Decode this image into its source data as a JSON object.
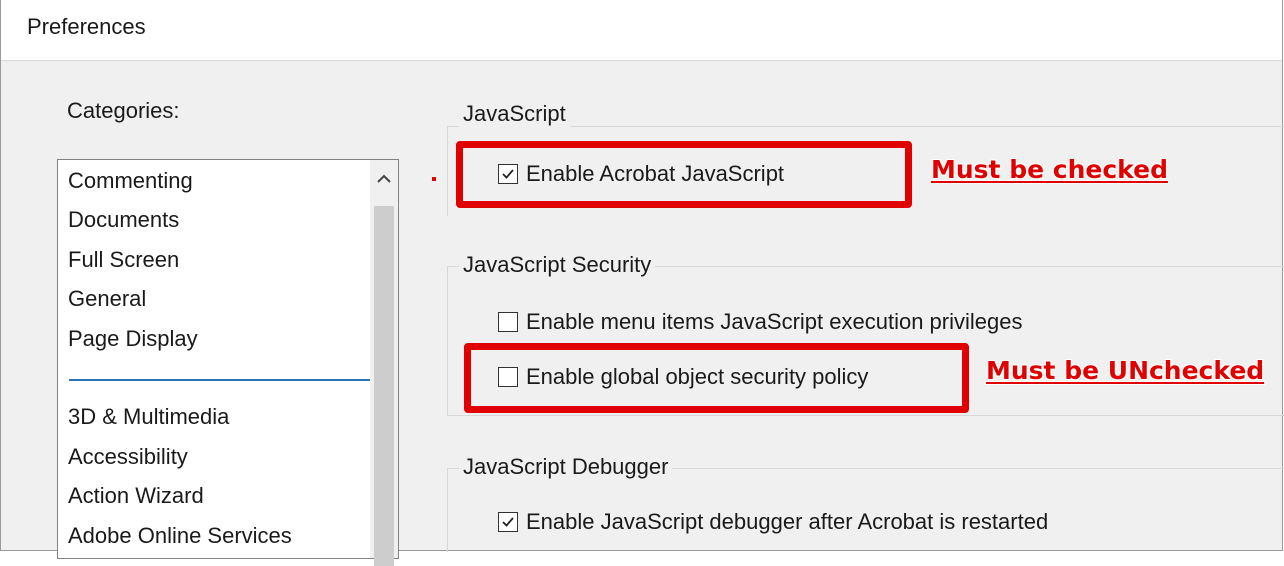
{
  "window": {
    "title": "Preferences"
  },
  "categories": {
    "label": "Categories:",
    "items": [
      "Commenting",
      "Documents",
      "Full Screen",
      "General",
      "Page Display",
      "3D & Multimedia",
      "Accessibility",
      "Action Wizard",
      "Adobe Online Services"
    ]
  },
  "javascript": {
    "title": "JavaScript",
    "enable_acrobat_js": {
      "label": "Enable Acrobat JavaScript",
      "checked": true
    }
  },
  "security": {
    "title": "JavaScript Security",
    "menu_items_privileges": {
      "label": "Enable menu items JavaScript execution privileges",
      "checked": false
    },
    "global_object_policy": {
      "label": "Enable global object security policy",
      "checked": false
    }
  },
  "debugger": {
    "title": "JavaScript Debugger",
    "enable_debugger": {
      "label": "Enable JavaScript debugger after Acrobat is restarted",
      "checked": true
    }
  },
  "annotations": {
    "must_checked": "Must be checked",
    "must_unchecked": "Must be UNchecked",
    "color": "#e00000"
  }
}
